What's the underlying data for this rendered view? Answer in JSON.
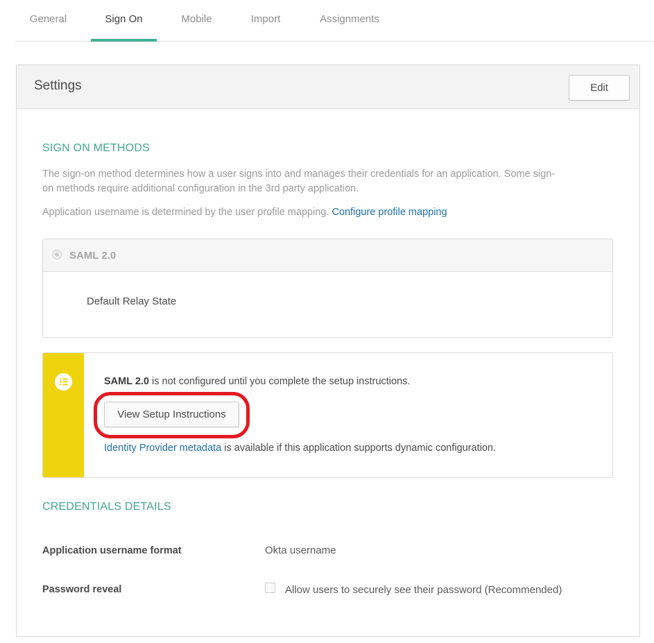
{
  "tabs": [
    {
      "label": "General"
    },
    {
      "label": "Sign On"
    },
    {
      "label": "Mobile"
    },
    {
      "label": "Import"
    },
    {
      "label": "Assignments"
    }
  ],
  "active_tab": "Sign On",
  "settings": {
    "title": "Settings",
    "edit_label": "Edit"
  },
  "sign_on_methods": {
    "heading": "SIGN ON METHODS",
    "description_line1": "The sign-on method determines how a user signs into and manages their credentials for an application. Some sign-",
    "description_line2": "on methods require additional configuration in the 3rd party application.",
    "username_text": "Application username is determined by the user profile mapping.",
    "configure_link": "Configure profile mapping",
    "method_label": "SAML 2.0",
    "relay_state_label": "Default Relay State"
  },
  "notice": {
    "bold_text": "SAML 2.0",
    "text": " is not configured until you complete the setup instructions.",
    "button_label": "View Setup Instructions",
    "metadata_link": "Identity Provider metadata",
    "metadata_text": " is available if this application supports dynamic configuration.",
    "icon": "list-icon",
    "accent_color": "#efd40d",
    "highlight_color": "#e21a22"
  },
  "credentials": {
    "heading": "CREDENTIALS DETAILS",
    "username_format_label": "Application username format",
    "username_format_value": "Okta username",
    "password_reveal_label": "Password reveal",
    "password_reveal_option": "Allow users to securely see their password (Recommended)",
    "password_reveal_checked": false
  },
  "colors": {
    "active_tab_underline": "#45b094",
    "section_heading": "#45a68c",
    "link": "#1f6fa8"
  }
}
